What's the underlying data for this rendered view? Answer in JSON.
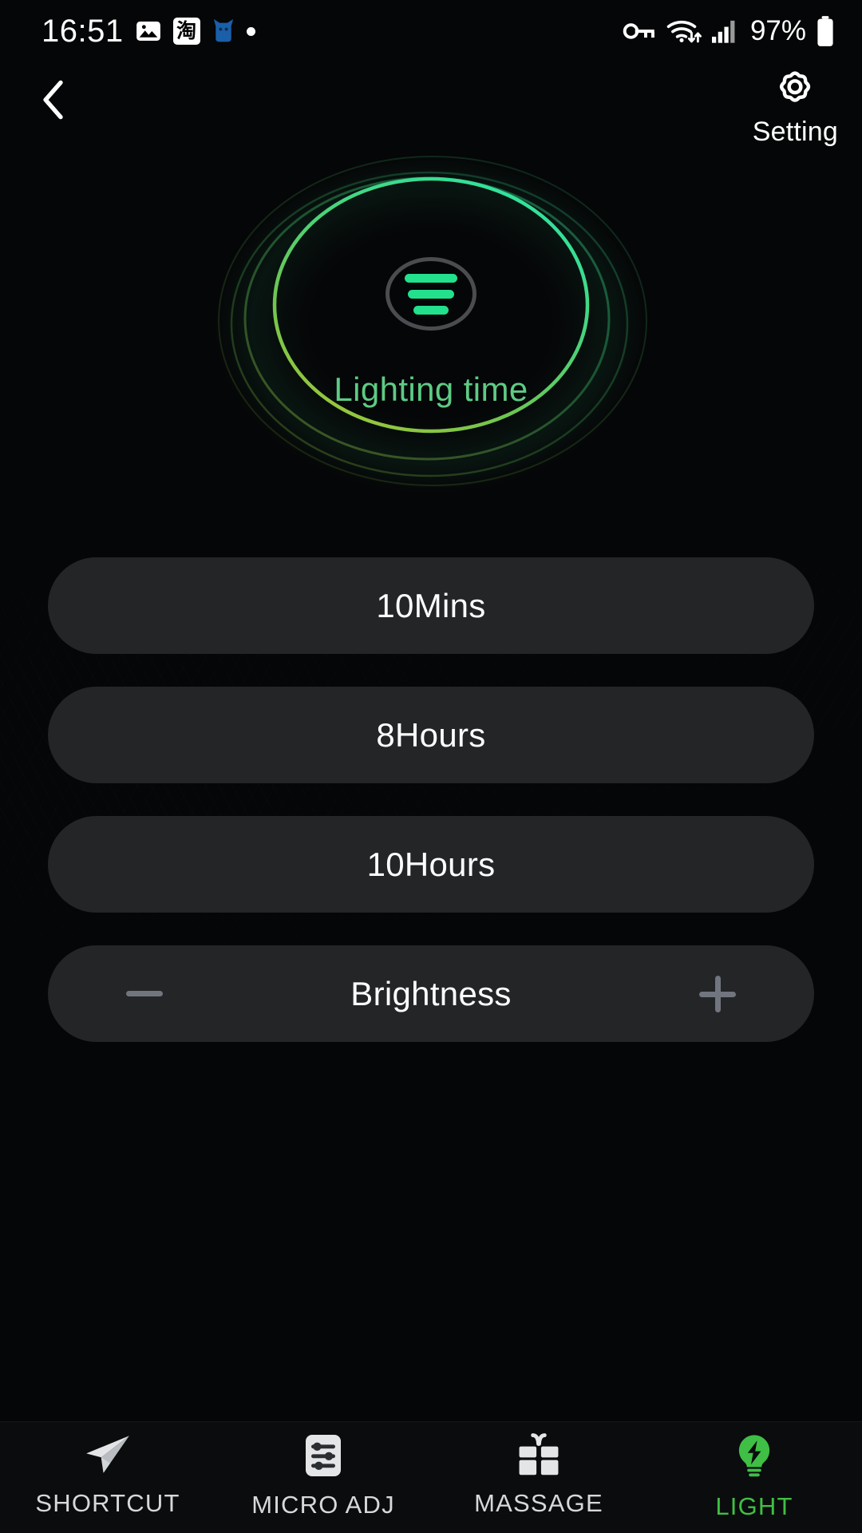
{
  "status_bar": {
    "time": "16:51",
    "left_icons": [
      "gallery-icon",
      "taobao-icon",
      "tmall-cat-icon",
      "dot-icon"
    ],
    "taobao_glyph": "淘",
    "right_icons": [
      "vpn-key-icon",
      "wifi-icon",
      "cellular-signal-icon"
    ],
    "battery_percent": "97%"
  },
  "header": {
    "back_icon": "chevron-left-icon",
    "setting_icon": "gear-icon",
    "setting_label": "Setting"
  },
  "hero": {
    "icon_name": "light-bars-icon",
    "label": "Lighting time",
    "label_color": "#5ecb84",
    "ring_color_start": "#2fe4a0",
    "ring_color_mid": "#55c96a",
    "ring_color_end": "#9ac73a"
  },
  "options": [
    {
      "label": "10Mins",
      "name": "option-10mins"
    },
    {
      "label": "8Hours",
      "name": "option-8hours"
    },
    {
      "label": "10Hours",
      "name": "option-10hours"
    }
  ],
  "brightness": {
    "label": "Brightness",
    "minus_icon": "minus-icon",
    "plus_icon": "plus-icon"
  },
  "bottom_nav": {
    "items": [
      {
        "label": "SHORTCUT",
        "icon": "paper-plane-icon",
        "active": false
      },
      {
        "label": "MICRO ADJ",
        "icon": "sliders-icon",
        "active": false
      },
      {
        "label": "MASSAGE",
        "icon": "gift-icon",
        "active": false
      },
      {
        "label": "LIGHT",
        "icon": "lightbulb-bolt-icon",
        "active": true
      }
    ],
    "active_color": "#3fbf45"
  }
}
